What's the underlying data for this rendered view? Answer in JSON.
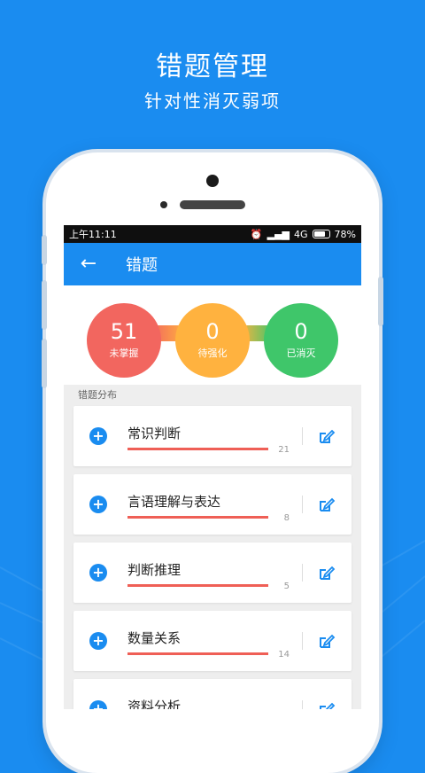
{
  "promo": {
    "title": "错题管理",
    "subtitle": "针对性消灭弱项"
  },
  "colors": {
    "brand_blue": "#1a8cf0",
    "red": "#f2665f",
    "orange": "#ffb23f",
    "green": "#3fc66a",
    "progress_red": "#ef5f56"
  },
  "status_bar": {
    "time": "上午11:11",
    "network": "4G",
    "battery": "78%",
    "icons": [
      "alarm-icon",
      "signal-icon",
      "battery-icon"
    ]
  },
  "app_bar": {
    "back_icon": "arrow-left-icon",
    "title": "错题"
  },
  "stats": [
    {
      "value": "51",
      "label": "未掌握",
      "color": "#f2665f"
    },
    {
      "value": "0",
      "label": "待强化",
      "color": "#ffb23f"
    },
    {
      "value": "0",
      "label": "已消灭",
      "color": "#3fc66a"
    }
  ],
  "section_label": "错题分布",
  "categories": [
    {
      "title": "常识判断",
      "count": "21",
      "progress": 1.0
    },
    {
      "title": "言语理解与表达",
      "count": "8",
      "progress": 1.0
    },
    {
      "title": "判断推理",
      "count": "5",
      "progress": 1.0
    },
    {
      "title": "数量关系",
      "count": "14",
      "progress": 1.0
    },
    {
      "title": "资料分析",
      "count": "",
      "progress": 1.0
    }
  ]
}
